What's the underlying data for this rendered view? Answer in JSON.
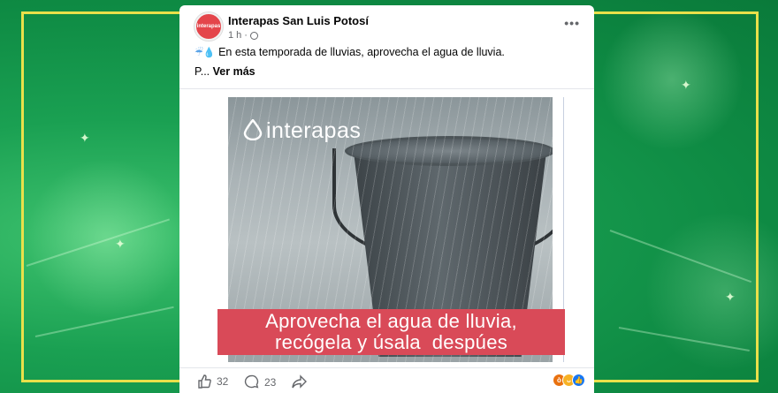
{
  "post": {
    "page_name": "Interapas San Luis Potosí",
    "time": "1 h",
    "separator": "·",
    "more_label": "•••",
    "text": "En esta temporada de lluvias, aprovecha el agua de lluvia.",
    "truncated_prefix": "P...",
    "see_more": "Ver más",
    "emojis": [
      "rain-cloud-icon",
      "droplet-icon"
    ]
  },
  "image": {
    "logo_text": "interapas",
    "caption_line1": "Aprovecha el agua de lluvia,",
    "caption_line2": "recógela y úsala  despúes"
  },
  "footer": {
    "likes": "32",
    "comments": "23",
    "reactions": [
      "angry",
      "haha",
      "like"
    ]
  },
  "colors": {
    "background": "#1aa052",
    "frame": "#e9e04a",
    "caption_bg": "#d94a58",
    "avatar": "#e4454b"
  }
}
